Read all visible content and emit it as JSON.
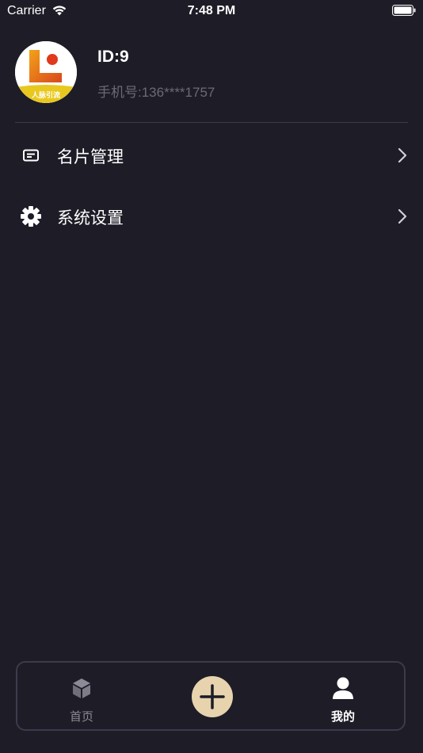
{
  "status_bar": {
    "carrier": "Carrier",
    "time": "7:48 PM"
  },
  "profile": {
    "id_text": "ID:9",
    "phone_text": "手机号:136****1757",
    "avatar_caption": "人脉引流"
  },
  "menu": {
    "items": [
      {
        "label": "名片管理",
        "icon": "card-icon"
      },
      {
        "label": "系统设置",
        "icon": "gear-icon"
      }
    ]
  },
  "tabbar": {
    "home_label": "首页",
    "mine_label": "我的",
    "add_icon": "plus-icon",
    "colors": {
      "accent": "#e7d3ad",
      "active": "#ffffff",
      "inactive": "#8b8a96"
    }
  }
}
